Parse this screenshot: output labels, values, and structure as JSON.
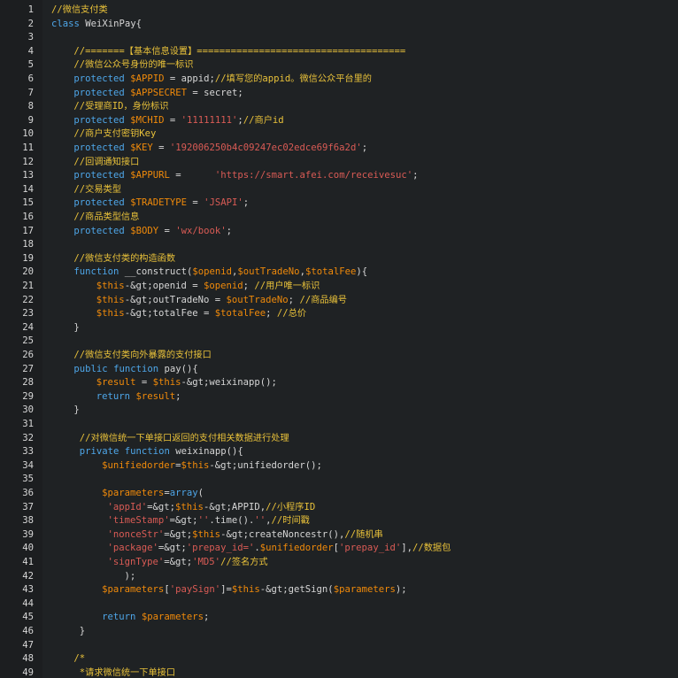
{
  "editor": {
    "theme": {
      "background": "#1f2224",
      "comment": "#e8c13a",
      "keyword": "#4ea6e8",
      "variable": "#f08a0a",
      "string": "#d95b55",
      "text": "#d6d6d6"
    },
    "lines": [
      {
        "n": "1",
        "indent": 0,
        "t": [
          [
            "cm",
            "//微信支付类"
          ]
        ]
      },
      {
        "n": "2",
        "indent": 0,
        "t": [
          [
            "kw",
            "class"
          ],
          [
            "tx",
            " WeiXinPay{"
          ]
        ]
      },
      {
        "n": "3",
        "indent": 0,
        "t": []
      },
      {
        "n": "4",
        "indent": 4,
        "t": [
          [
            "cm",
            "//=======【基本信息设置】====================================="
          ]
        ]
      },
      {
        "n": "5",
        "indent": 4,
        "t": [
          [
            "cm",
            "//微信公众号身份的唯一标识"
          ]
        ]
      },
      {
        "n": "6",
        "indent": 4,
        "t": [
          [
            "kw",
            "protected"
          ],
          [
            "tx",
            " "
          ],
          [
            "vr",
            "$APPID"
          ],
          [
            "tx",
            " = appid;"
          ],
          [
            "cm",
            "//填写您的appid。微信公众平台里的"
          ]
        ]
      },
      {
        "n": "7",
        "indent": 4,
        "t": [
          [
            "kw",
            "protected"
          ],
          [
            "tx",
            " "
          ],
          [
            "vr",
            "$APPSECRET"
          ],
          [
            "tx",
            " = secret;"
          ]
        ]
      },
      {
        "n": "8",
        "indent": 4,
        "t": [
          [
            "cm",
            "//受理商ID，身份标识"
          ]
        ]
      },
      {
        "n": "9",
        "indent": 4,
        "t": [
          [
            "kw",
            "protected"
          ],
          [
            "tx",
            " "
          ],
          [
            "vr",
            "$MCHID"
          ],
          [
            "tx",
            " = "
          ],
          [
            "st",
            "'11111111'"
          ],
          [
            "tx",
            ";"
          ],
          [
            "cm",
            "//商户id"
          ]
        ]
      },
      {
        "n": "10",
        "indent": 4,
        "t": [
          [
            "cm",
            "//商户支付密钥Key"
          ]
        ]
      },
      {
        "n": "11",
        "indent": 4,
        "t": [
          [
            "kw",
            "protected"
          ],
          [
            "tx",
            " "
          ],
          [
            "vr",
            "$KEY"
          ],
          [
            "tx",
            " = "
          ],
          [
            "st",
            "'192006250b4c09247ec02edce69f6a2d'"
          ],
          [
            "tx",
            ";"
          ]
        ]
      },
      {
        "n": "12",
        "indent": 4,
        "t": [
          [
            "cm",
            "//回调通知接口"
          ]
        ]
      },
      {
        "n": "13",
        "indent": 4,
        "t": [
          [
            "kw",
            "protected"
          ],
          [
            "tx",
            " "
          ],
          [
            "vr",
            "$APPURL"
          ],
          [
            "tx",
            " =      "
          ],
          [
            "st",
            "'https://smart.afei.com/receivesuc'"
          ],
          [
            "tx",
            ";"
          ]
        ]
      },
      {
        "n": "14",
        "indent": 4,
        "t": [
          [
            "cm",
            "//交易类型"
          ]
        ]
      },
      {
        "n": "15",
        "indent": 4,
        "t": [
          [
            "kw",
            "protected"
          ],
          [
            "tx",
            " "
          ],
          [
            "vr",
            "$TRADETYPE"
          ],
          [
            "tx",
            " = "
          ],
          [
            "st",
            "'JSAPI'"
          ],
          [
            "tx",
            ";"
          ]
        ]
      },
      {
        "n": "16",
        "indent": 4,
        "t": [
          [
            "cm",
            "//商品类型信息"
          ]
        ]
      },
      {
        "n": "17",
        "indent": 4,
        "t": [
          [
            "kw",
            "protected"
          ],
          [
            "tx",
            " "
          ],
          [
            "vr",
            "$BODY"
          ],
          [
            "tx",
            " = "
          ],
          [
            "st",
            "'wx/book'"
          ],
          [
            "tx",
            ";"
          ]
        ]
      },
      {
        "n": "18",
        "indent": 0,
        "t": []
      },
      {
        "n": "19",
        "indent": 4,
        "t": [
          [
            "cm",
            "//微信支付类的构造函数"
          ]
        ]
      },
      {
        "n": "20",
        "indent": 4,
        "t": [
          [
            "kw",
            "function"
          ],
          [
            "tx",
            " __construct("
          ],
          [
            "vr",
            "$openid"
          ],
          [
            "tx",
            ","
          ],
          [
            "vr",
            "$outTradeNo"
          ],
          [
            "tx",
            ","
          ],
          [
            "vr",
            "$totalFee"
          ],
          [
            "tx",
            "){"
          ]
        ]
      },
      {
        "n": "21",
        "indent": 8,
        "t": [
          [
            "vr",
            "$this"
          ],
          [
            "tx",
            "-&gt;openid = "
          ],
          [
            "vr",
            "$openid"
          ],
          [
            "tx",
            "; "
          ],
          [
            "cm",
            "//用户唯一标识"
          ]
        ]
      },
      {
        "n": "22",
        "indent": 8,
        "t": [
          [
            "vr",
            "$this"
          ],
          [
            "tx",
            "-&gt;outTradeNo = "
          ],
          [
            "vr",
            "$outTradeNo"
          ],
          [
            "tx",
            "; "
          ],
          [
            "cm",
            "//商品编号"
          ]
        ]
      },
      {
        "n": "23",
        "indent": 8,
        "t": [
          [
            "vr",
            "$this"
          ],
          [
            "tx",
            "-&gt;totalFee = "
          ],
          [
            "vr",
            "$totalFee"
          ],
          [
            "tx",
            "; "
          ],
          [
            "cm",
            "//总价"
          ]
        ]
      },
      {
        "n": "24",
        "indent": 4,
        "t": [
          [
            "tx",
            "}"
          ]
        ]
      },
      {
        "n": "25",
        "indent": 0,
        "t": []
      },
      {
        "n": "26",
        "indent": 4,
        "t": [
          [
            "cm",
            "//微信支付类向外暴露的支付接口"
          ]
        ]
      },
      {
        "n": "27",
        "indent": 4,
        "t": [
          [
            "kw",
            "public"
          ],
          [
            "tx",
            " "
          ],
          [
            "kw",
            "function"
          ],
          [
            "tx",
            " pay(){"
          ]
        ]
      },
      {
        "n": "28",
        "indent": 8,
        "t": [
          [
            "vr",
            "$result"
          ],
          [
            "tx",
            " = "
          ],
          [
            "vr",
            "$this"
          ],
          [
            "tx",
            "-&gt;weixinapp();"
          ]
        ]
      },
      {
        "n": "29",
        "indent": 8,
        "t": [
          [
            "kw",
            "return"
          ],
          [
            "tx",
            " "
          ],
          [
            "vr",
            "$result"
          ],
          [
            "tx",
            ";"
          ]
        ]
      },
      {
        "n": "30",
        "indent": 4,
        "t": [
          [
            "tx",
            "}"
          ]
        ]
      },
      {
        "n": "31",
        "indent": 0,
        "t": []
      },
      {
        "n": "32",
        "indent": 5,
        "t": [
          [
            "cm",
            "//对微信统一下单接口返回的支付相关数据进行处理"
          ]
        ]
      },
      {
        "n": "33",
        "indent": 5,
        "t": [
          [
            "kw",
            "private"
          ],
          [
            "tx",
            " "
          ],
          [
            "kw",
            "function"
          ],
          [
            "tx",
            " weixinapp(){"
          ]
        ]
      },
      {
        "n": "34",
        "indent": 9,
        "t": [
          [
            "vr",
            "$unifiedorder"
          ],
          [
            "tx",
            "="
          ],
          [
            "vr",
            "$this"
          ],
          [
            "tx",
            "-&gt;unifiedorder();"
          ]
        ]
      },
      {
        "n": "35",
        "indent": 0,
        "t": []
      },
      {
        "n": "36",
        "indent": 9,
        "t": [
          [
            "vr",
            "$parameters"
          ],
          [
            "tx",
            "="
          ],
          [
            "kw",
            "array"
          ],
          [
            "tx",
            "("
          ]
        ]
      },
      {
        "n": "37",
        "indent": 10,
        "t": [
          [
            "st",
            "'appId'"
          ],
          [
            "tx",
            "=&gt;"
          ],
          [
            "vr",
            "$this"
          ],
          [
            "tx",
            "-&gt;APPID,"
          ],
          [
            "cm",
            "//小程序ID"
          ]
        ]
      },
      {
        "n": "38",
        "indent": 10,
        "t": [
          [
            "st",
            "'timeStamp'"
          ],
          [
            "tx",
            "=&gt;"
          ],
          [
            "st",
            "''"
          ],
          [
            "tx",
            ".time()."
          ],
          [
            "st",
            "''"
          ],
          [
            "tx",
            ","
          ],
          [
            "cm",
            "//时间戳"
          ]
        ]
      },
      {
        "n": "39",
        "indent": 10,
        "t": [
          [
            "st",
            "'nonceStr'"
          ],
          [
            "tx",
            "=&gt;"
          ],
          [
            "vr",
            "$this"
          ],
          [
            "tx",
            "-&gt;createNoncestr(),"
          ],
          [
            "cm",
            "//随机串"
          ]
        ]
      },
      {
        "n": "40",
        "indent": 10,
        "t": [
          [
            "st",
            "'package'"
          ],
          [
            "tx",
            "=&gt;"
          ],
          [
            "st",
            "'prepay_id='"
          ],
          [
            "tx",
            "."
          ],
          [
            "vr",
            "$unifiedorder"
          ],
          [
            "tx",
            "["
          ],
          [
            "st",
            "'prepay_id'"
          ],
          [
            "tx",
            "],"
          ],
          [
            "cm",
            "//数据包"
          ]
        ]
      },
      {
        "n": "41",
        "indent": 10,
        "t": [
          [
            "st",
            "'signType'"
          ],
          [
            "tx",
            "=&gt;"
          ],
          [
            "st",
            "'MD5'"
          ],
          [
            "cm",
            "//签名方式"
          ]
        ]
      },
      {
        "n": "42",
        "indent": 13,
        "t": [
          [
            "tx",
            ");"
          ]
        ]
      },
      {
        "n": "43",
        "indent": 9,
        "t": [
          [
            "vr",
            "$parameters"
          ],
          [
            "tx",
            "["
          ],
          [
            "st",
            "'paySign'"
          ],
          [
            "tx",
            "]="
          ],
          [
            "vr",
            "$this"
          ],
          [
            "tx",
            "-&gt;getSign("
          ],
          [
            "vr",
            "$parameters"
          ],
          [
            "tx",
            ");"
          ]
        ]
      },
      {
        "n": "44",
        "indent": 0,
        "t": []
      },
      {
        "n": "45",
        "indent": 9,
        "t": [
          [
            "kw",
            "return"
          ],
          [
            "tx",
            " "
          ],
          [
            "vr",
            "$parameters"
          ],
          [
            "tx",
            ";"
          ]
        ]
      },
      {
        "n": "46",
        "indent": 5,
        "t": [
          [
            "tx",
            "}"
          ]
        ]
      },
      {
        "n": "47",
        "indent": 0,
        "t": []
      },
      {
        "n": "48",
        "indent": 4,
        "t": [
          [
            "cm",
            "/*"
          ]
        ]
      },
      {
        "n": "49",
        "indent": 5,
        "t": [
          [
            "cm",
            "*请求微信统一下单接口"
          ]
        ]
      }
    ]
  }
}
